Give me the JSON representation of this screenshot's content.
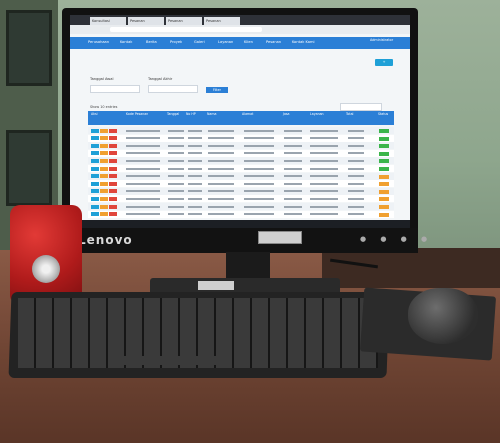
{
  "brand": "Lenovo",
  "colors": {
    "navbar": "#2b7fd6",
    "accent": "#1ea0d7",
    "speaker": "#c52420"
  },
  "browser": {
    "tabs": [
      "Konsultasi",
      "Pesanan",
      "Pesanan",
      "Pesanan"
    ]
  },
  "app": {
    "navbar_items": [
      "Perusahaan",
      "Kontak",
      "Berita",
      "Proyek",
      "Galeri",
      "Layanan",
      "Klien",
      "Pesanan",
      "Kontak Kami"
    ],
    "user_label": "Administrator"
  },
  "filters": {
    "from_label": "Tanggal Awal",
    "to_label": "Tanggal Akhir",
    "filter_button": "Filter"
  },
  "table": {
    "show_label": "Show 10 entries",
    "headers": [
      "Aksi",
      "Kode Pesanan",
      "Tanggal",
      "No HP",
      "Nama",
      "Alamat",
      "Jasa",
      "Layanan",
      "Total",
      "Status"
    ],
    "rows": [
      {
        "status_color": "#3bb54a"
      },
      {
        "status_color": "#3bb54a"
      },
      {
        "status_color": "#3bb54a"
      },
      {
        "status_color": "#3bb54a"
      },
      {
        "status_color": "#3bb54a"
      },
      {
        "status_color": "#3bb54a"
      },
      {
        "status_color": "#f0a030"
      },
      {
        "status_color": "#f0a030"
      },
      {
        "status_color": "#f0a030"
      },
      {
        "status_color": "#f0a030"
      },
      {
        "status_color": "#f0a030"
      },
      {
        "status_color": "#f0a030"
      }
    ]
  }
}
